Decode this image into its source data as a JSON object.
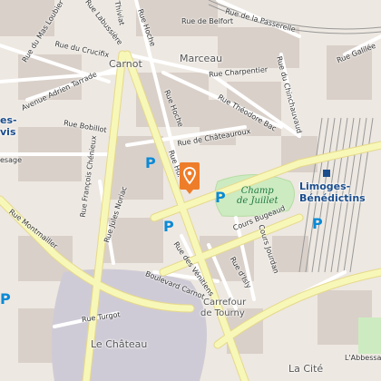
{
  "colors": {
    "background": "#ede8e1",
    "block": "#d9d0c9",
    "road_major": "#f7f7b8",
    "road_minor": "#ffffff",
    "park": "#cdebc0",
    "railway": "#9a9a9a",
    "parking": "#0a8ad6",
    "marker": "#ee7d2a",
    "station_text": "#1b4d8c"
  },
  "places": {
    "marceau": "Marceau",
    "carnot": "Carnot",
    "le_chateau": "Le Château",
    "la_cite": "La Cité",
    "carrefour_line1": "Carrefour",
    "carrefour_line2": "de Tourny",
    "limoges_line1": "Limoges-",
    "limoges_line2": "Bénédictins",
    "left_edge_1": "es-",
    "left_edge_2": "vis"
  },
  "park": {
    "line1": "Champ",
    "line2": "de Juillet"
  },
  "streets": {
    "mas_loubier": "Rue du Mas Loubier",
    "labussiere": "Rue Labussière",
    "thiviat": "Thiviat",
    "hoche_top": "Rue Hoche",
    "belfort": "Rue de Belfort",
    "passerelle": "Rue de la Passerelle",
    "galilee": "Rue Galilée",
    "crucifix": "Rue du Crucifix",
    "adrien_tarrade": "Avenue Adrien Tarrade",
    "bobillot": "Rue Bobillot",
    "charpentier": "Rue Charpentier",
    "chinchauvaud": "Rue du Chinchauvaud",
    "theodore_bac": "Rue Théodore Bac",
    "hoche_mid": "Rue Hoche",
    "chateauroux": "Rue de Châteauroux",
    "hoche_low": "Rue Ho.",
    "sesage": "esage",
    "francois_chenieux": "Rue François Chénieux",
    "jules_noriac": "Rue Jules Noriac",
    "montmailler": "Rue Montmailler",
    "cours_bugeaud": "Cours Bugeaud",
    "cours_jourdan": "Cours Jourdan",
    "isly": "Rue d'Isly",
    "des_venitiens": "Rue des Vénitiens",
    "boulevard_carnot": "Boulevard Carnot",
    "turgot": "Rue Turgot",
    "abbessaille": "L'Abbessa"
  }
}
